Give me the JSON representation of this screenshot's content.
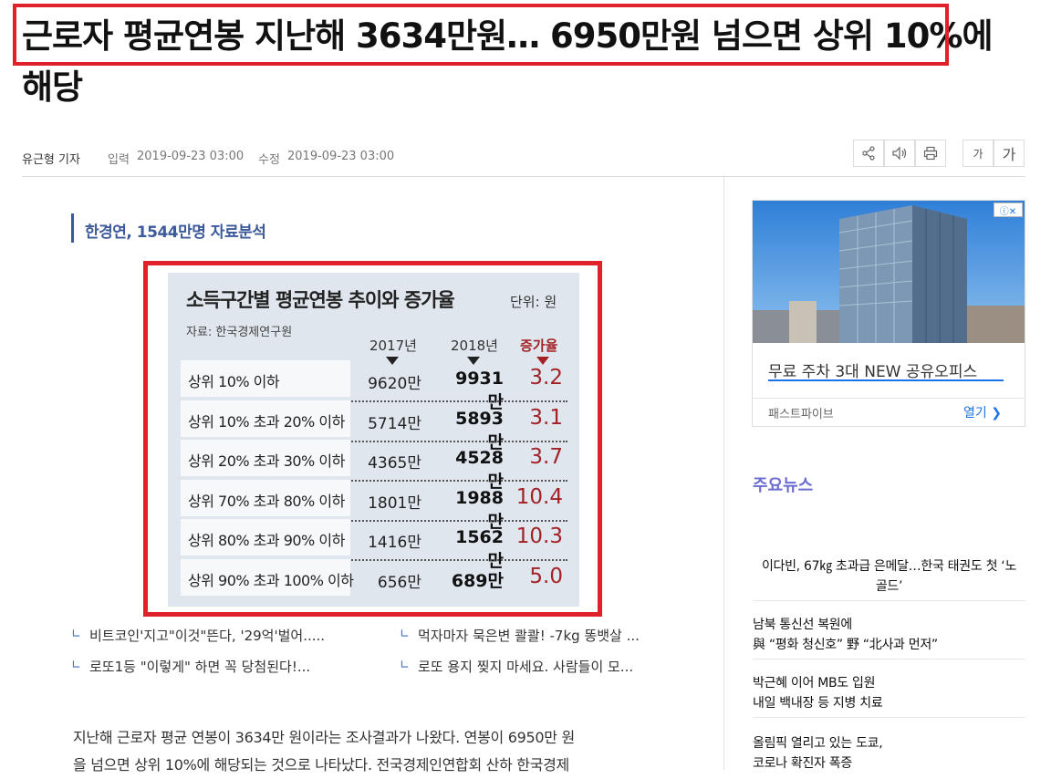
{
  "article": {
    "headline": "근로자 평균연봉 지난해 3634만원… 6950만원 넘으면 상위 10%에 해당",
    "reporter": "유근형 기자",
    "input_label": "입력",
    "input_date": "2019-09-23 03:00",
    "edit_label": "수정",
    "edit_date": "2019-09-23 03:00",
    "font_small": "가",
    "font_large": "가",
    "subheading": "한경연, 1544만명 자료분석",
    "body_lines": [
      "지난해 근로자 평균 연봉이 3634만 원이라는 조사결과가 나왔다. 연봉이 6950만 원",
      "을 넘으면 상위 10%에 해당되는 것으로 나타났다. 전국경제인연합회 산하 한국경제"
    ]
  },
  "toolbar_icons": [
    "share-icon",
    "speaker-icon",
    "print-icon"
  ],
  "infographic": {
    "title": "소득구간별 평균연봉 추이와 증가율",
    "unit": "단위: 원",
    "source": "자료: 한국경제연구원",
    "col_2017": "2017년",
    "col_2018": "2018년",
    "col_rate": "증가율",
    "rows": [
      {
        "label": "상위 10% 이하",
        "v2017": "9620만",
        "v2018": "9931만",
        "rate": "3.2"
      },
      {
        "label": "상위 10% 초과 20% 이하",
        "v2017": "5714만",
        "v2018": "5893만",
        "rate": "3.1"
      },
      {
        "label": "상위 20% 초과 30% 이하",
        "v2017": "4365만",
        "v2018": "4528만",
        "rate": "3.7"
      },
      {
        "label": "상위 70% 초과 80% 이하",
        "v2017": "1801만",
        "v2018": "1988만",
        "rate": "10.4"
      },
      {
        "label": "상위 80% 초과 90% 이하",
        "v2017": "1416만",
        "v2018": "1562만",
        "rate": "10.3"
      },
      {
        "label": "상위 90% 초과 100% 이하",
        "v2017": "656만",
        "v2018": "689만",
        "rate": "5.0"
      }
    ]
  },
  "related_links": [
    "비트코인'지고\"이것\"뜬다, '29억'벌어.....",
    "먹자마자 묵은변 콸콸! -7kg 똥뱃살 ...",
    "로또1등 \"이렇게\" 하면 꼭 당첨된다!...",
    "로또 용지 찢지 마세요. 사람들이 모..."
  ],
  "ad": {
    "title": "무료 주차 3대 NEW 공유오피스",
    "advertiser": "패스트파이브",
    "open_label": "열기 ❯"
  },
  "main_news": {
    "title": "주요뉴스",
    "items": [
      {
        "line1": "이다빈, 67㎏ 초과급 은메달…한국 태권도 첫 ‘노",
        "line2": "골드’"
      },
      {
        "line1": "남북 통신선 복원에",
        "line2": "與 “평화 청신호” 野 “北사과 먼저”"
      },
      {
        "line1": "박근혜 이어 MB도 입원",
        "line2": "내일 백내장 등 지병 치료"
      },
      {
        "line1": "올림픽 열리고 있는 도쿄,",
        "line2": "코로나 확진자 폭증"
      }
    ]
  },
  "colors": {
    "highlight_red": "#e0212a",
    "accent_blue": "#3c5a9a",
    "rate_red": "#a32225",
    "news_title": "#6a6cd4"
  }
}
